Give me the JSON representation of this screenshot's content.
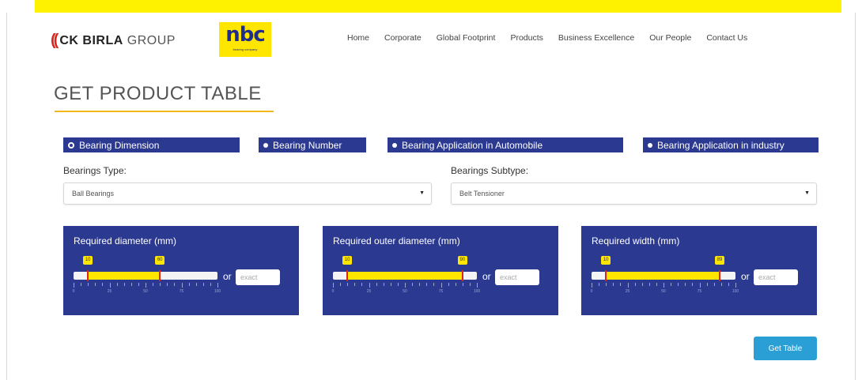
{
  "header": {
    "brand_mark": "((",
    "brand_strong": "CK BIRLA",
    "brand_light": "GROUP",
    "nbc_logo": "nbc",
    "nbc_tagline": "bearing company",
    "nav": [
      "Home",
      "Corporate",
      "Global Footprint",
      "Products",
      "Business Excellence",
      "Our People",
      "Contact Us"
    ]
  },
  "page_title": "GET PRODUCT TABLE",
  "tabs": [
    {
      "label": "Bearing Dimension",
      "active": true
    },
    {
      "label": "Bearing Number",
      "active": false
    },
    {
      "label": "Bearing Application in Automobile",
      "active": false
    },
    {
      "label": "Bearing Application in industry",
      "active": false
    }
  ],
  "bearings_type": {
    "label": "Bearings Type:",
    "value": "Ball Bearings"
  },
  "bearings_subtype": {
    "label": "Bearings Subtype:",
    "value": "Belt Tensioner"
  },
  "panels": [
    {
      "title": "Required diameter (mm)",
      "min_label": "10",
      "max_label": "60",
      "range_min": 10,
      "range_max": 60,
      "or": "or",
      "placeholder": "exact",
      "ticks": [
        "0",
        "25",
        "50",
        "75",
        "100"
      ]
    },
    {
      "title": "Required outer diameter (mm)",
      "min_label": "10",
      "max_label": "90",
      "range_min": 10,
      "range_max": 90,
      "or": "or",
      "placeholder": "exact",
      "ticks": [
        "0",
        "25",
        "50",
        "75",
        "100"
      ]
    },
    {
      "title": "Required width (mm)",
      "min_label": "10",
      "max_label": "89",
      "range_min": 10,
      "range_max": 89,
      "or": "or",
      "placeholder": "exact",
      "ticks": [
        "0",
        "25",
        "50",
        "75",
        "100"
      ]
    }
  ],
  "get_table_button": "Get Table",
  "colors": {
    "top_strip": "#fff200",
    "panel_blue": "#2b3991",
    "slider_fill": "#ffe600",
    "handle_red": "#d9251c",
    "button_blue": "#2a9fd6",
    "title_underline": "#f2b718"
  }
}
